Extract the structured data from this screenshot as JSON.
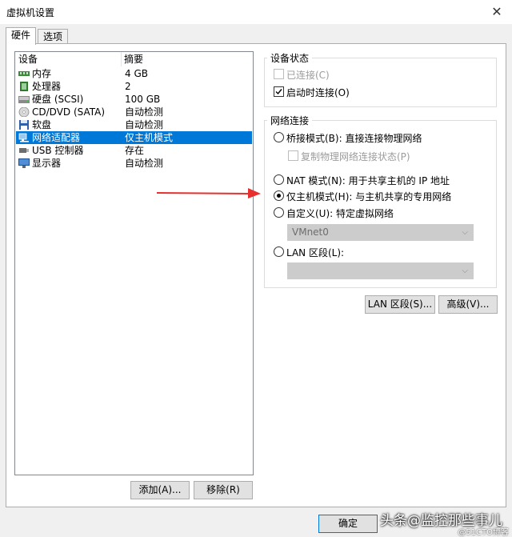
{
  "window": {
    "title": "虚拟机设置",
    "close": "✕"
  },
  "tabs": [
    {
      "label": "硬件"
    },
    {
      "label": "选项"
    }
  ],
  "device_list": {
    "headers": {
      "device": "设备",
      "summary": "摘要"
    },
    "rows": [
      {
        "name": "内存",
        "summary": "4 GB",
        "icon": "memory-icon"
      },
      {
        "name": "处理器",
        "summary": "2",
        "icon": "processor-icon"
      },
      {
        "name": "硬盘 (SCSI)",
        "summary": "100 GB",
        "icon": "harddisk-icon"
      },
      {
        "name": "CD/DVD (SATA)",
        "summary": "自动检测",
        "icon": "cd-dvd-icon"
      },
      {
        "name": "软盘",
        "summary": "自动检测",
        "icon": "floppy-icon"
      },
      {
        "name": "网络适配器",
        "summary": "仅主机模式",
        "icon": "network-adapter-icon",
        "selected": true
      },
      {
        "name": "USB 控制器",
        "summary": "存在",
        "icon": "usb-icon"
      },
      {
        "name": "显示器",
        "summary": "自动检测",
        "icon": "display-icon"
      }
    ],
    "add_label": "添加(A)...",
    "remove_label": "移除(R)"
  },
  "device_status": {
    "title": "设备状态",
    "connected": {
      "label": "已连接(C)",
      "checked": false,
      "disabled": true
    },
    "connect_at_power_on": {
      "label": "启动时连接(O)",
      "checked": true
    }
  },
  "network_connection": {
    "title": "网络连接",
    "bridged": {
      "label": "桥接模式(B): 直接连接物理网络",
      "selected": false
    },
    "replicate": {
      "label": "复制物理网络连接状态(P)",
      "disabled": true
    },
    "nat": {
      "label": "NAT 模式(N): 用于共享主机的 IP 地址",
      "selected": false
    },
    "host_only": {
      "label": "仅主机模式(H): 与主机共享的专用网络",
      "selected": true
    },
    "custom": {
      "label": "自定义(U): 特定虚拟网络",
      "selected": false
    },
    "custom_value": "VMnet0",
    "lan_segment": {
      "label": "LAN 区段(L):",
      "selected": false
    },
    "lan_segment_value": ""
  },
  "buttons": {
    "lan_segments": "LAN 区段(S)...",
    "advanced": "高级(V)...",
    "ok": "确定"
  },
  "watermark": {
    "main": "头条@监控那些事儿",
    "sub": "@51CTO博客"
  },
  "colors": {
    "selection": "#0078d7",
    "arrow": "#e8302e"
  }
}
